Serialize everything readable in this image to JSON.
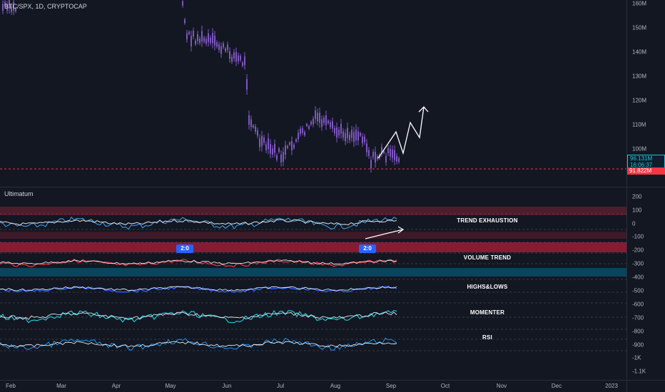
{
  "header": {
    "symbol": "BTC/SPX, 1D, CRYPTOCAP"
  },
  "indicator_panel": {
    "name": "Ultimatum"
  },
  "price_axis": {
    "labels": [
      "160M",
      "150M",
      "140M",
      "130M",
      "120M",
      "110M",
      "100M"
    ],
    "current_price": "96.131M",
    "countdown": "16:06:37",
    "marked_price": "91.822M"
  },
  "indicator_axis": {
    "labels": [
      "200",
      "100",
      "0",
      "-100",
      "-200",
      "-300",
      "-400",
      "-500",
      "-600",
      "-700",
      "-800",
      "-900",
      "-1K",
      "-1.1K"
    ]
  },
  "time_axis": {
    "labels": [
      "Feb",
      "Mar",
      "Apr",
      "May",
      "Jun",
      "Jul",
      "Aug",
      "Sep",
      "Oct",
      "Nov",
      "Dec",
      "2023"
    ]
  },
  "indicators": {
    "trend_exhaustion": "TREND EXHAUSTION",
    "volume_trend": "VOLUME TREND",
    "highs_lows": "HIGHS&LOWS",
    "momenter": "MOMENTER",
    "rsi": "RSI"
  },
  "badges": {
    "first": "2:0",
    "second": "2:0"
  },
  "colors": {
    "background": "#131722",
    "candles": "#7e57c2",
    "accent_cyan": "#22c4d8",
    "accent_red": "#f23645",
    "badge_blue": "#2962ff"
  }
}
